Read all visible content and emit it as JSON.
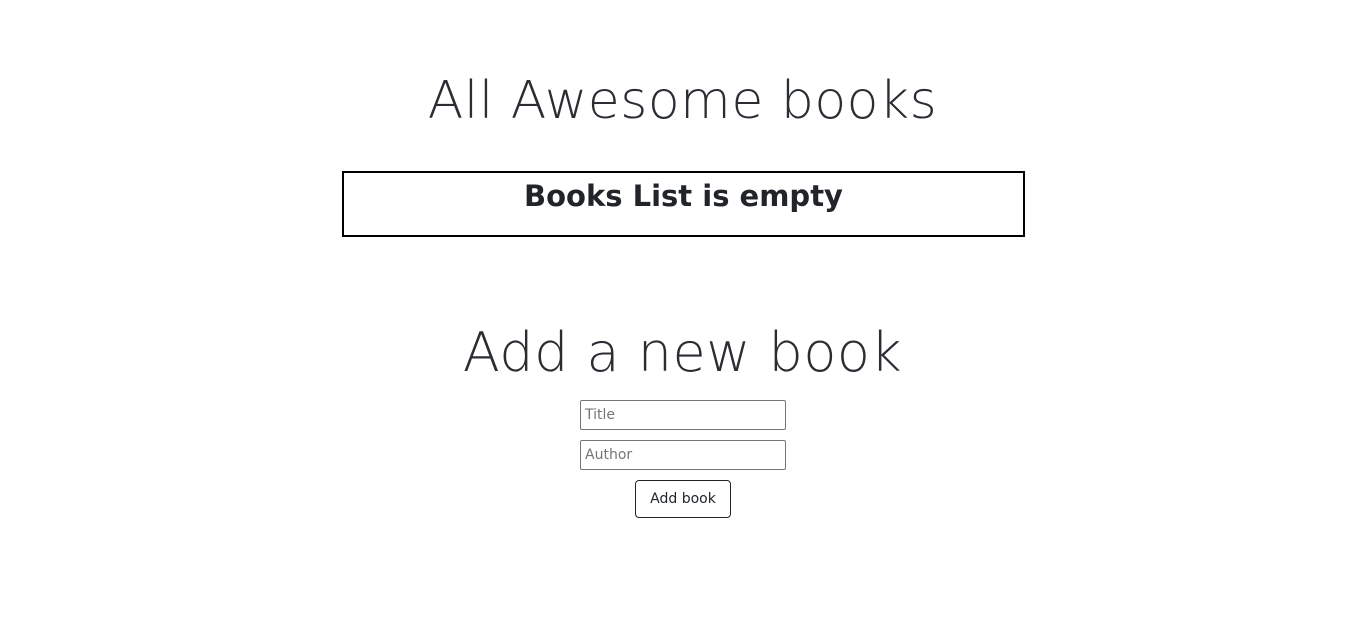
{
  "header": {
    "title": "All Awesome books"
  },
  "books_list": {
    "empty_message": "Books List is empty"
  },
  "add_form": {
    "heading": "Add a new book",
    "title_input": {
      "placeholder": "Title",
      "value": ""
    },
    "author_input": {
      "placeholder": "Author",
      "value": ""
    },
    "submit_label": "Add book"
  }
}
